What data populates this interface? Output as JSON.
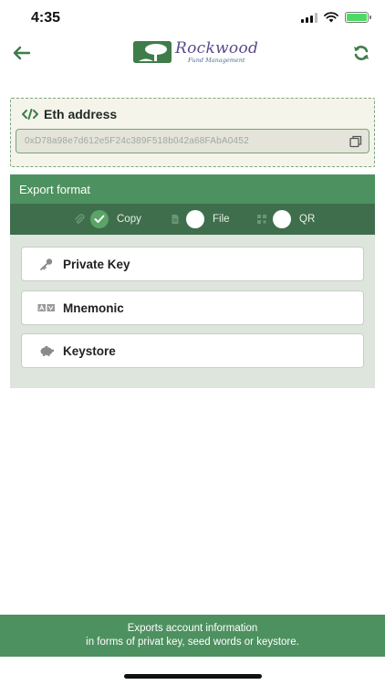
{
  "status_bar": {
    "time": "4:35"
  },
  "header": {
    "logo_name": "Rockwood",
    "logo_sub": "Fund Management"
  },
  "address": {
    "title": "Eth address",
    "value": "0xD78a98e7d612e5F24c389F518b042a68FAbA0452"
  },
  "export": {
    "title": "Export format",
    "formats": [
      {
        "label": "Copy",
        "selected": true
      },
      {
        "label": "File",
        "selected": false
      },
      {
        "label": "QR",
        "selected": false
      }
    ],
    "options": [
      {
        "label": "Private Key",
        "icon": "key-icon"
      },
      {
        "label": "Mnemonic",
        "icon": "mnemonic-icon"
      },
      {
        "label": "Keystore",
        "icon": "piggy-bank-icon"
      }
    ]
  },
  "footer": {
    "line1": "Exports account information",
    "line2": "in forms of privat key, seed words or keystore."
  },
  "colors": {
    "primary_green": "#4e9160",
    "dark_green": "#3f6e4c",
    "panel_bg": "#dde5dc",
    "card_bg": "#f4f4ea",
    "logo_purple": "#5a4a8c"
  }
}
